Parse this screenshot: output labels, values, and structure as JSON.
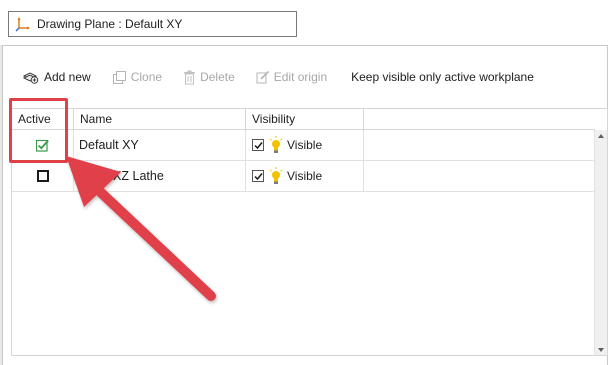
{
  "drawing_plane": {
    "label": "Drawing Plane : Default XY",
    "icon": "axis-icon"
  },
  "toolbar": {
    "add_new": "Add new",
    "clone": "Clone",
    "delete": "Delete",
    "edit_origin": "Edit origin",
    "keep_visible": "Keep visible only active workplane"
  },
  "grid": {
    "columns": [
      "Active",
      "Name",
      "Visibility"
    ],
    "rows": [
      {
        "active": true,
        "name": "Default XY",
        "visible_checked": true,
        "visibility": "Visible"
      },
      {
        "active": false,
        "name": "efault XZ Lathe",
        "visible_checked": true,
        "visibility": "Visible"
      }
    ]
  },
  "colors": {
    "annotation": "#e04048",
    "active_check": "#3a9a4a",
    "bulb": "#f2c200",
    "disabled_text": "#a8a8a8"
  }
}
